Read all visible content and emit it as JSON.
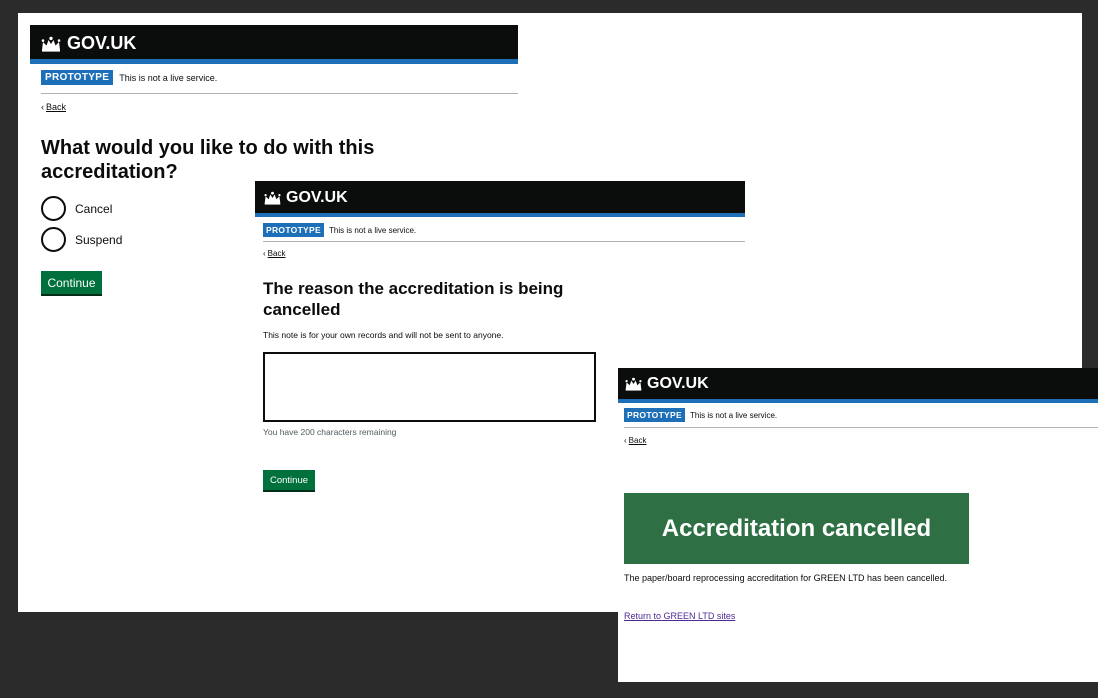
{
  "header": {
    "brand": "GOV.UK"
  },
  "banner": {
    "tag": "PROTOTYPE",
    "text": "This is not a live service."
  },
  "back_label": "Back",
  "screen1": {
    "heading": "What would you like to do with this accreditation?",
    "options": [
      "Cancel",
      "Suspend"
    ],
    "continue_label": "Continue"
  },
  "screen2": {
    "heading": "The reason the accreditation is being cancelled",
    "hint": "This note is for your own records and will not be sent to anyone.",
    "textarea_value": "",
    "char_count": "You have 200 characters remaining",
    "continue_label": "Continue"
  },
  "screen3": {
    "panel_title": "Accreditation cancelled",
    "body": "The paper/board reprocessing accreditation for GREEN LTD has been cancelled.",
    "link": "Return to GREEN LTD sites"
  },
  "colors": {
    "header": "#0b0c0c",
    "header_rule": "#1d70b8",
    "tag": "#1d70b8",
    "button": "#00703c",
    "panel": "#2e7043",
    "link": "#4c2c92",
    "backdrop": "#2b2b2b"
  }
}
